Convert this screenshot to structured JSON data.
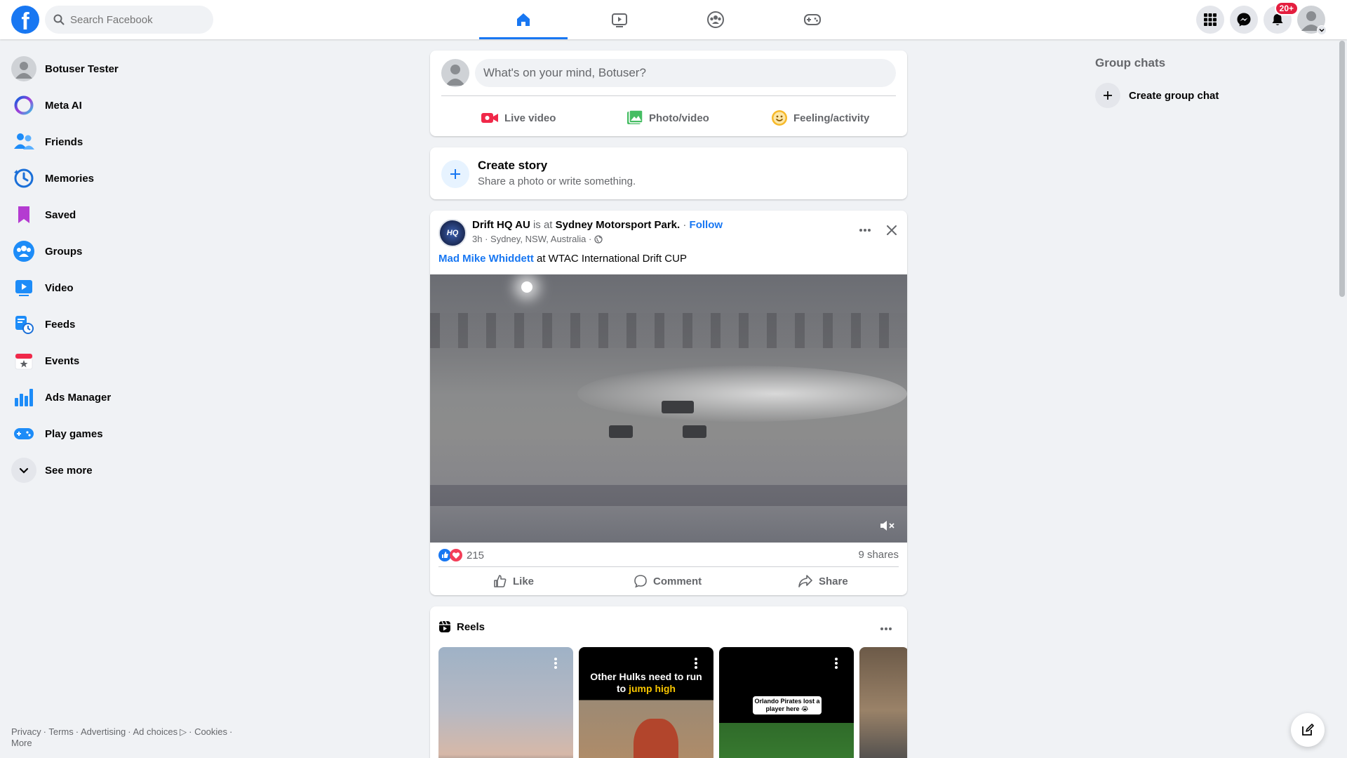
{
  "topbar": {
    "logo": "f",
    "search_placeholder": "Search Facebook",
    "tabs": [
      {
        "name": "home",
        "active": true
      },
      {
        "name": "video",
        "active": false
      },
      {
        "name": "groups",
        "active": false
      },
      {
        "name": "gaming",
        "active": false
      }
    ],
    "notifications_badge": "20+",
    "accent": "#1877f2"
  },
  "sidebar": {
    "items": [
      {
        "label": "Botuser Tester",
        "icon": "profile-avatar"
      },
      {
        "label": "Meta AI",
        "icon": "meta-ai-icon"
      },
      {
        "label": "Friends",
        "icon": "friends-icon"
      },
      {
        "label": "Memories",
        "icon": "memories-icon"
      },
      {
        "label": "Saved",
        "icon": "saved-icon"
      },
      {
        "label": "Groups",
        "icon": "groups-icon"
      },
      {
        "label": "Video",
        "icon": "video-icon"
      },
      {
        "label": "Feeds",
        "icon": "feeds-icon"
      },
      {
        "label": "Events",
        "icon": "events-icon"
      },
      {
        "label": "Ads Manager",
        "icon": "ads-manager-icon"
      },
      {
        "label": "Play games",
        "icon": "play-games-icon"
      },
      {
        "label": "See more",
        "icon": "chevron-down-icon"
      }
    ],
    "footer": {
      "privacy": "Privacy",
      "terms": "Terms",
      "advertising": "Advertising",
      "ad_choices": "Ad choices",
      "cookies": "Cookies",
      "more": "More"
    }
  },
  "composer": {
    "placeholder": "What's on your mind, Botuser?",
    "live_video": "Live video",
    "photo_video": "Photo/video",
    "feeling": "Feeling/activity"
  },
  "story": {
    "title": "Create story",
    "subtitle": "Share a photo or write something."
  },
  "post": {
    "avatar_text": "HQ",
    "author": "Drift HQ AU",
    "is_at": "is at",
    "place": "Sydney Motorsport Park.",
    "follow": "Follow",
    "time": "3h",
    "location": "Sydney, NSW, Australia",
    "text_link": "Mad Mike Whiddett",
    "text_rest": " at WTAC International Drift CUP",
    "reactions_count": "215",
    "shares": "9 shares",
    "like": "Like",
    "comment": "Comment",
    "share": "Share"
  },
  "reels": {
    "title": "Reels",
    "reel2_caption_white": "Other Hulks need to run to ",
    "reel2_caption_yellow": "jump high",
    "reel3_caption": "Orlando Pirates lost a player here 😭"
  },
  "right": {
    "group_chats": "Group chats",
    "create_group_chat": "Create group chat"
  }
}
